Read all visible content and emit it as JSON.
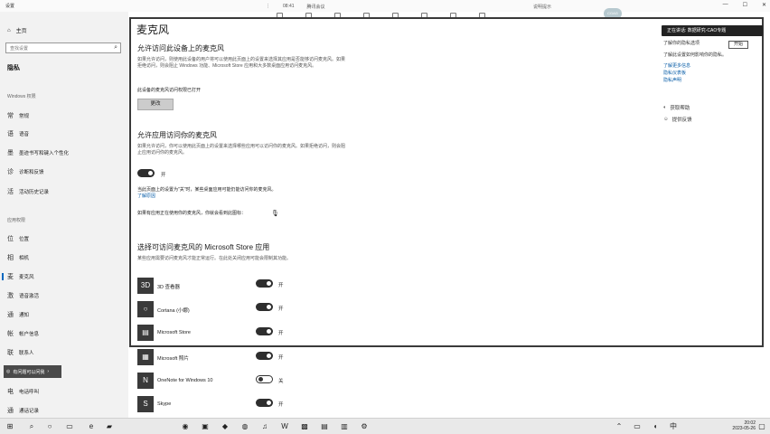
{
  "window": {
    "title": "设置",
    "controls": [
      "—",
      "☐",
      "✕"
    ]
  },
  "recorder": {
    "time": "08:41",
    "meeting": "腾讯会议",
    "tools": [
      "静音",
      "开启视频",
      "共享屏幕",
      "管理成员",
      "聊天",
      "录制",
      "设置",
      "结束共享"
    ],
    "right_text": "说明提示",
    "avatar": "CGAG"
  },
  "sidebar": {
    "home": "主页",
    "search_placeholder": "查找设置",
    "section": "隐私",
    "group_windows": "Windows 权限",
    "group_apps": "应用权限",
    "items_windows": [
      {
        "icon": "常",
        "label": "常规"
      },
      {
        "icon": "语",
        "label": "语音"
      },
      {
        "icon": "墨",
        "label": "墨迹书写和键入个性化"
      },
      {
        "icon": "诊",
        "label": "诊断和反馈"
      },
      {
        "icon": "活",
        "label": "活动历史记录"
      }
    ],
    "items_apps": [
      {
        "icon": "位",
        "label": "位置"
      },
      {
        "icon": "相",
        "label": "相机"
      },
      {
        "icon": "麦",
        "label": "麦克风"
      },
      {
        "icon": "激",
        "label": "语音激活"
      },
      {
        "icon": "通",
        "label": "通知"
      },
      {
        "icon": "帐",
        "label": "帐户信息"
      },
      {
        "icon": "联",
        "label": "联系人"
      }
    ],
    "items_bottom": [
      {
        "icon": "电",
        "label": "电话呼叫"
      },
      {
        "icon": "通",
        "label": "通话记录"
      }
    ],
    "cortana_tip": "有问题可以问我"
  },
  "main": {
    "title": "麦克风",
    "device_heading": "允许访问此设备上的麦克风",
    "device_desc": "如果允许访问，则使用此设备的用户将可以使用此页面上的设置来选择其应用是否能够访问麦克风。如果拒绝访问，则会阻止 Windows 功能、Microsoft Store 应用和大多数桌面应用访问麦克风。",
    "device_status": "此设备的麦克风访问权限已打开",
    "change_button": "更改",
    "apps_heading": "允许应用访问你的麦克风",
    "apps_desc": "如果允许访问，你可以使用此页面上的设置来选择哪些应用可以访问你的麦克风。如果拒绝访问，则会阻止应用访问你的麦克风。",
    "apps_toggle_label": "开",
    "note1": "当此页面上的设置为\"关\"时，某些桌面应用可能仍能访问你的麦克风。",
    "note1_link": "了解原因",
    "note2": "如果有应用正在使用你的麦克风，你就会看到此图标：",
    "store_heading": "选择可访问麦克风的 Microsoft Store 应用",
    "store_desc": "某些应用需要访问麦克风才能正常运行。在此处关闭应用可能会限制其功能。",
    "apps": [
      {
        "icon": "3D",
        "name": "3D 查看器",
        "state": "开",
        "on": true
      },
      {
        "icon": "○",
        "name": "Cortana (小娜)",
        "state": "开",
        "on": true
      },
      {
        "icon": "▤",
        "name": "Microsoft Store",
        "state": "开",
        "on": true
      },
      {
        "icon": "▦",
        "name": "Microsoft 照片",
        "state": "开",
        "on": true
      },
      {
        "icon": "N",
        "name": "OneNote for Windows 10",
        "state": "关",
        "on": false
      },
      {
        "icon": "S",
        "name": "Skype",
        "state": "开",
        "on": true
      }
    ]
  },
  "right": {
    "rec_badge": "正在讲话: 数据研究-CAO专题",
    "open_button": "开始",
    "line1": "了解你的隐私选项",
    "line2": "了解此设置如何影响你的隐私。",
    "link1": "了解更多信息",
    "link2": "隐私仪表板",
    "link3": "隐私声明",
    "help": "获取帮助",
    "feedback": "提供反馈"
  },
  "taskbar": {
    "time": "20:02",
    "date": "2023-05-26"
  }
}
